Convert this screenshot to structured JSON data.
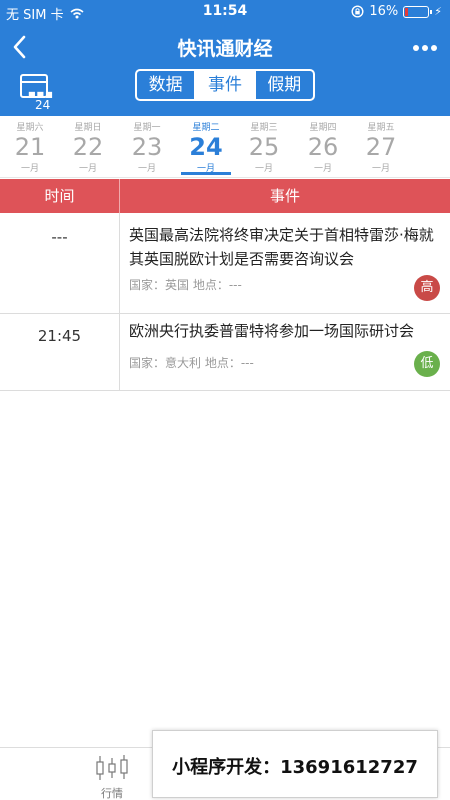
{
  "status_bar": {
    "carrier": "无 SIM 卡",
    "time": "11:54",
    "battery_percent": "16%",
    "battery_level": 0.16
  },
  "nav": {
    "title": "快讯通财经"
  },
  "tabs": [
    {
      "label": "数据",
      "active": false
    },
    {
      "label": "事件",
      "active": true
    },
    {
      "label": "假期",
      "active": false
    }
  ],
  "calendar_icon": {
    "day": "24"
  },
  "days": [
    {
      "weekday": "星期六",
      "date": "21",
      "month": "一月"
    },
    {
      "weekday": "星期日",
      "date": "22",
      "month": "一月"
    },
    {
      "weekday": "星期一",
      "date": "23",
      "month": "一月"
    },
    {
      "weekday": "星期二",
      "date": "24",
      "month": "一月",
      "active": true
    },
    {
      "weekday": "星期三",
      "date": "25",
      "month": "一月"
    },
    {
      "weekday": "星期四",
      "date": "26",
      "month": "一月"
    },
    {
      "weekday": "星期五",
      "date": "27",
      "month": "一月"
    }
  ],
  "table": {
    "headers": {
      "time": "时间",
      "event": "事件"
    },
    "rows": [
      {
        "time": "---",
        "title": "英国最高法院将终审决定关于首相特雷莎·梅就其英国脱欧计划是否需要咨询议会",
        "meta": "国家：英国  地点：---",
        "importance": "高",
        "importance_color": "#c94a47"
      },
      {
        "time": "21:45",
        "title": "欧洲央行执委普雷特将参加一场国际研讨会",
        "meta": "国家：意大利  地点：---",
        "importance": "低",
        "importance_color": "#6ab04c"
      }
    ]
  },
  "bottom_bar": {
    "market_label": "行情",
    "promo_text": "小程序开发：13691612727"
  },
  "colors": {
    "primary": "#2b7fd8",
    "header_red": "#de5358"
  }
}
